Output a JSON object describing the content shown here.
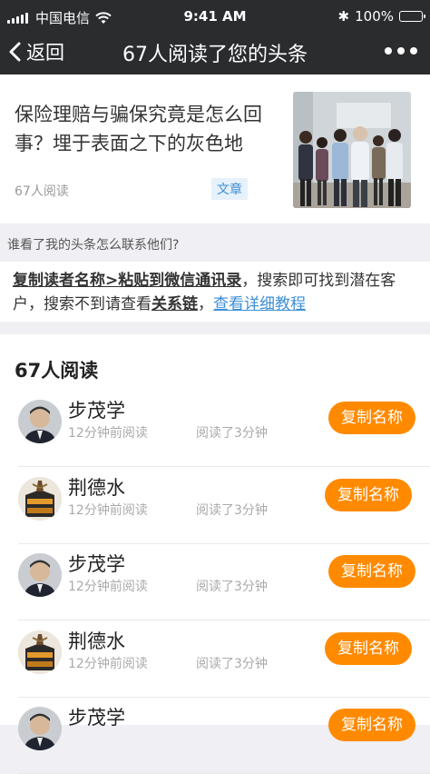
{
  "status": {
    "carrier": "中国电信",
    "time": "9:41 AM",
    "battery": "100%",
    "battery_level": 1.0
  },
  "nav": {
    "back_label": "返回",
    "title": "67人阅读了您的头条"
  },
  "article": {
    "title": "保险理赔与骗保究竟是怎么回事？埋于表面之下的灰色地",
    "reads": "67人阅读",
    "tag": "文章"
  },
  "help": {
    "heading": "谁看了我的头条怎么联系他们?",
    "bold1": "复制读者名称>粘贴到微信通讯录",
    "text1": "，搜索即可找到潜在客户，搜索不到请查看",
    "bold2": "关系链",
    "text2": "，",
    "link": "查看详细教程"
  },
  "readers": {
    "title": "67人阅读",
    "copy_label": "复制名称",
    "items": [
      {
        "name": "步茂学",
        "ago": "12分钟前阅读",
        "duration": "阅读了3分钟",
        "avatar": "portrait-avatar"
      },
      {
        "name": "荆德水",
        "ago": "12分钟前阅读",
        "duration": "阅读了3分钟",
        "avatar": "sculpture-avatar"
      },
      {
        "name": "步茂学",
        "ago": "12分钟前阅读",
        "duration": "阅读了3分钟",
        "avatar": "portrait-avatar"
      },
      {
        "name": "荆德水",
        "ago": "12分钟前阅读",
        "duration": "阅读了3分钟",
        "avatar": "sculpture-avatar"
      },
      {
        "name": "步茂学",
        "ago": "",
        "duration": "",
        "avatar": "portrait-avatar"
      }
    ]
  },
  "colors": {
    "nav_bg": "#2b2c2e",
    "accent": "#ff8a00",
    "link": "#3d8fd7"
  }
}
